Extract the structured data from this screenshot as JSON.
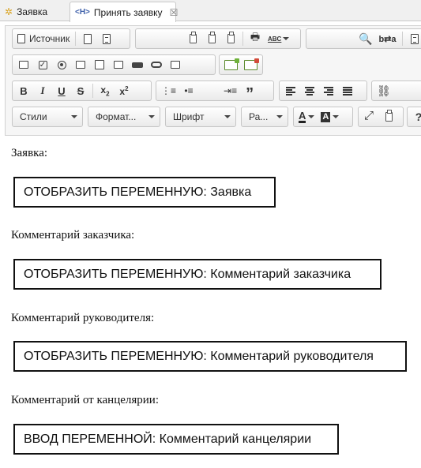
{
  "tabs": [
    {
      "label": "Заявка",
      "icon": "form-icon"
    },
    {
      "label": "Принять заявку",
      "icon": "html-icon",
      "close": "☒"
    }
  ],
  "toolbar": {
    "source_label": "Источник",
    "styles_label": "Стили",
    "format_label": "Формат...",
    "font_label": "Шрифт",
    "size_label": "Ра...",
    "abc_label": "ABC",
    "help_label": "?"
  },
  "content": [
    {
      "label": "Заявка:",
      "field": "ОТОБРАЗИТЬ ПЕРЕМЕННУЮ: Заявка"
    },
    {
      "label": "Комментарий заказчика:",
      "field": "ОТОБРАЗИТЬ ПЕРЕМЕННУЮ: Комментарий заказчика"
    },
    {
      "label": "Комментарий руководителя:",
      "field": "ОТОБРАЗИТЬ ПЕРЕМЕННУЮ: Комментарий руководителя"
    },
    {
      "label": "Комментарий от канцелярии:",
      "field": "ВВОД ПЕРЕМЕННОЙ: Комментарий канцелярии"
    }
  ]
}
